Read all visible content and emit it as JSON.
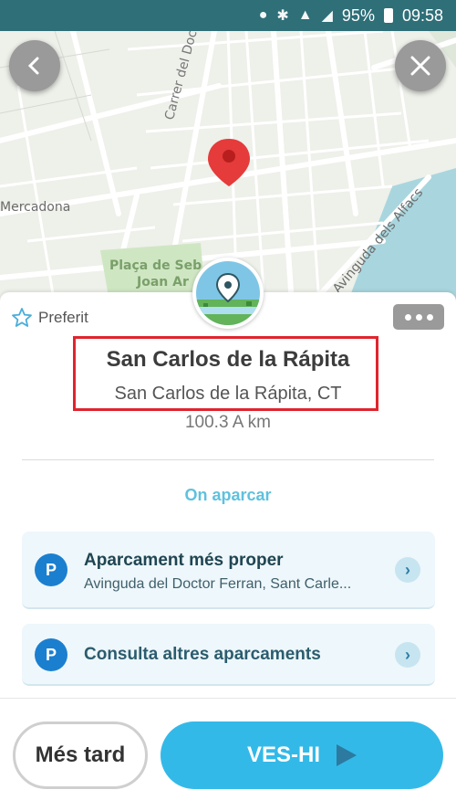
{
  "status_bar": {
    "battery": "95%",
    "time": "09:58",
    "icons": [
      "location-icon",
      "bluetooth-icon",
      "wifi-icon",
      "signal-icon",
      "battery-icon"
    ]
  },
  "map": {
    "labels": {
      "street_doctor": "Carrer del Doctor",
      "mercadona": "Mercadona",
      "placa": "Plaça de Seb",
      "joan": "Joan Ar",
      "alfacs": "Avinguda dels Alfacs"
    },
    "pin_color": "#e53b3b"
  },
  "card": {
    "favorite_label": "Preferit",
    "title": "San Carlos de la Rápita",
    "subtitle": "San Carlos de la Rápita, CT",
    "distance": "100.3 A km",
    "section_title": "On aparcar",
    "parking": [
      {
        "icon_label": "P",
        "title": "Aparcament més proper",
        "subtitle": "Avinguda del Doctor Ferran, Sant Carle..."
      },
      {
        "icon_label": "P",
        "title": "Consulta altres aparcaments"
      }
    ]
  },
  "actions": {
    "later_label": "Més tard",
    "go_label": "VES-HI"
  },
  "colors": {
    "status_bar": "#2e6f78",
    "accent": "#33b9e8",
    "highlight": "#e0252e",
    "parking_icon": "#1b7fcf"
  }
}
